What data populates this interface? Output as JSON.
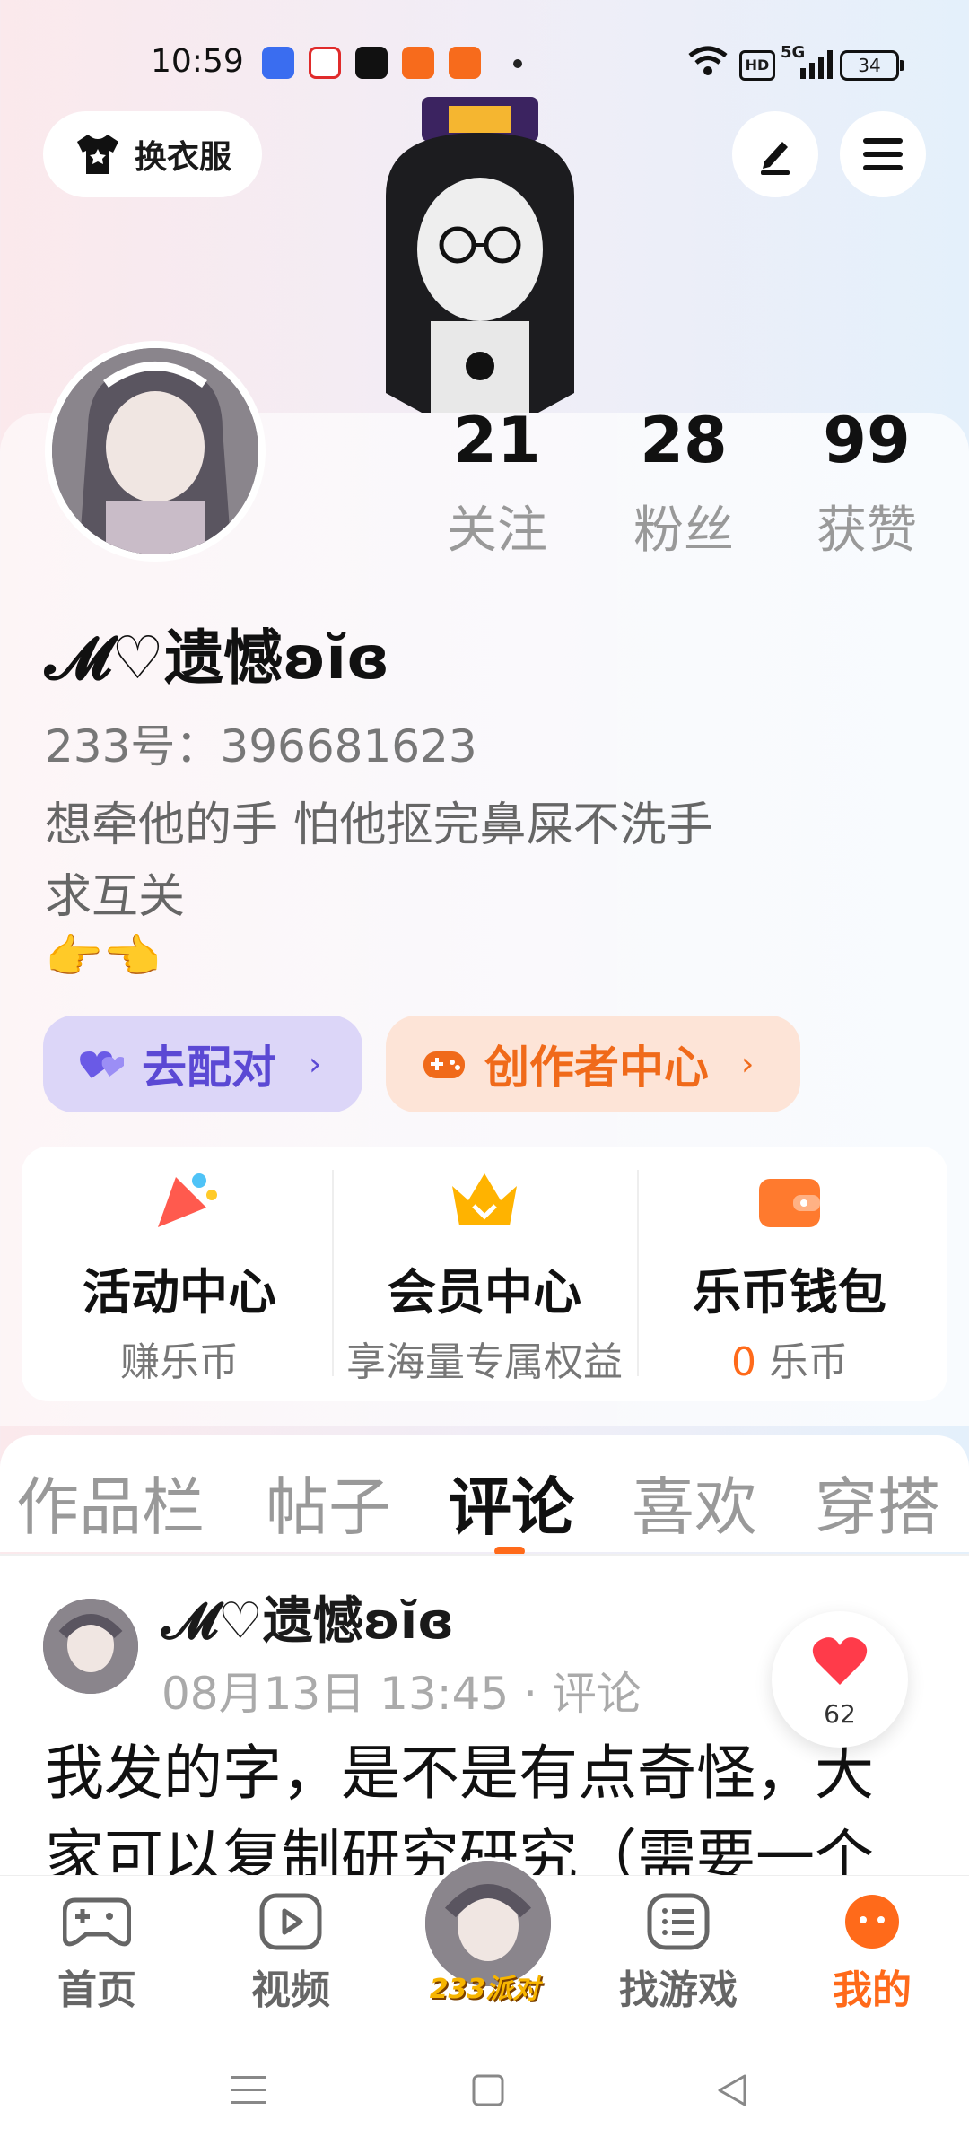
{
  "status_bar": {
    "time": "10:59",
    "battery": "34",
    "network": "5G",
    "hd": "HD"
  },
  "top": {
    "dress_label": "换衣服"
  },
  "profile": {
    "name": "𝓜♡遗憾ʚĭɞ",
    "uid": "233号：396681623",
    "bio": "想牵他的手 怕他抠完鼻屎不洗手\n求互关",
    "bio_emoji": "👉👈",
    "stats": [
      {
        "value": "21",
        "label": "关注"
      },
      {
        "value": "28",
        "label": "粉丝"
      },
      {
        "value": "99",
        "label": "获赞"
      }
    ]
  },
  "actions": {
    "match_label": "去配对",
    "creator_label": "创作者中心"
  },
  "features": [
    {
      "title": "活动中心",
      "sub": "赚乐币"
    },
    {
      "title": "会员中心",
      "sub": "享海量专属权益"
    },
    {
      "title": "乐币钱包",
      "sub_value": "0",
      "sub_unit": "乐币"
    }
  ],
  "tabs": [
    "作品栏",
    "帖子",
    "评论",
    "喜欢",
    "穿搭"
  ],
  "active_tab": "评论",
  "comment": {
    "name": "𝓜♡遗憾ʚĭɞ",
    "meta": "08月13日 13:45 · 评论",
    "text": "我发的字，是不是有点奇怪，大家可以复制研究研究（需要一个赞）",
    "likes": "62"
  },
  "bottom_nav": {
    "items": [
      "首页",
      "视频",
      "找游戏",
      "我的"
    ],
    "party_label": "233派对",
    "active": "我的"
  },
  "colors": {
    "accent": "#ff6a1a",
    "match": "#5b49d4",
    "like": "#ff3b4a"
  }
}
